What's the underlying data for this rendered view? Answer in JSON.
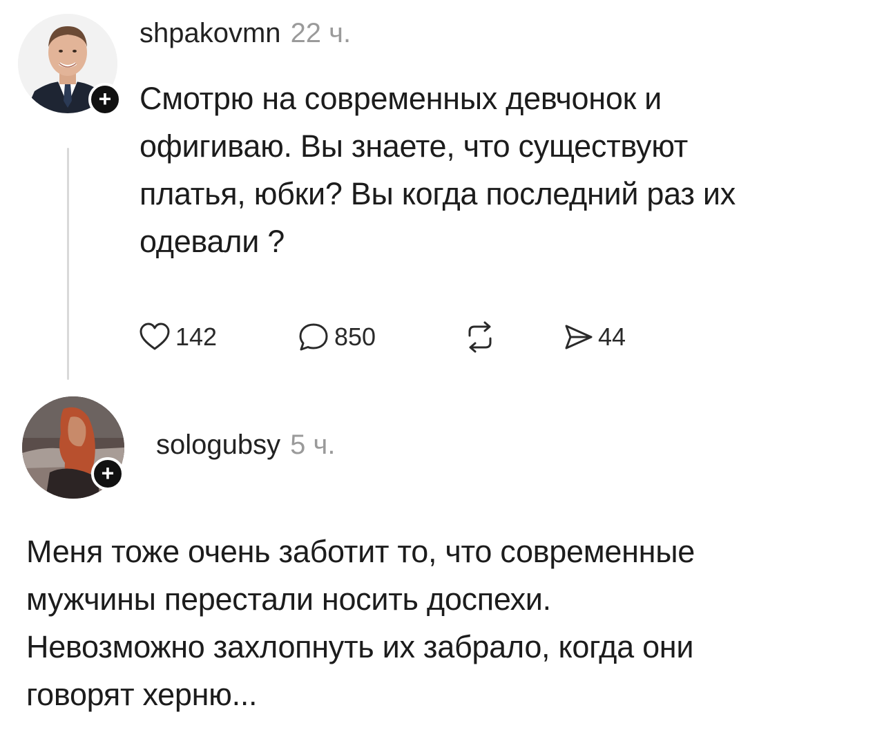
{
  "posts": [
    {
      "username": "shpakovmn",
      "time": "22 ч.",
      "text_lines": [
        "Смотрю на современных девчонок и",
        "офигиваю. Вы знаете, что существуют",
        "платья, юбки? Вы когда последний раз их",
        "одевали ?"
      ],
      "likes": "142",
      "comments": "850",
      "shares": "44",
      "avatar_icon": "man-in-suit-avatar"
    },
    {
      "username": "sologubsy",
      "time": "5 ч.",
      "text_lines": [
        "Меня тоже очень заботит то, что современные",
        "мужчины перестали носить доспехи.",
        "Невозможно захлопнуть их забрало, когда они",
        "говорят херню..."
      ],
      "avatar_icon": "red-haired-woman-avatar"
    }
  ],
  "badge_symbol": "+",
  "icons": {
    "like": "heart-icon",
    "comment": "comment-bubble-icon",
    "repost": "repost-icon",
    "share": "send-icon"
  },
  "colors": {
    "text": "#1c1c1c",
    "muted": "#9a9a9a",
    "badge": "#111111",
    "thread_line": "#d9d9d9"
  }
}
